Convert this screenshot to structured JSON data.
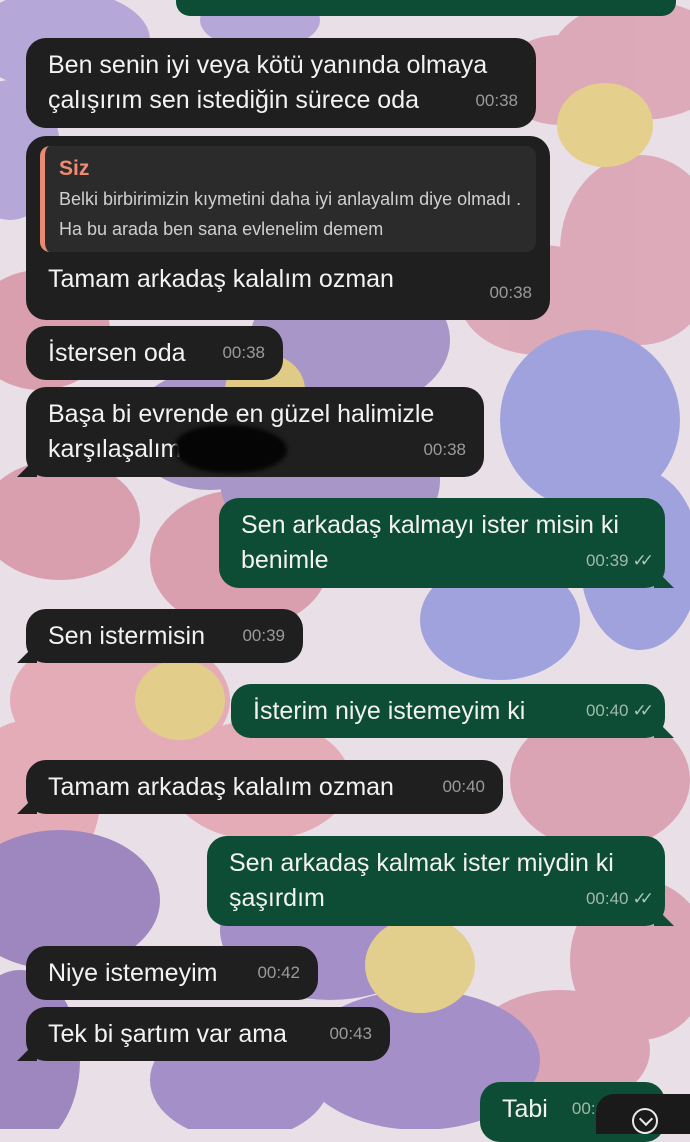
{
  "messages": [
    {
      "id": "m1",
      "dir": "in",
      "text": "Ben senin iyi veya kötü yanında olmaya\nçalışırım sen istediğin sürece oda",
      "time": "00:38"
    },
    {
      "id": "m2",
      "dir": "in",
      "text": "Tamam arkadaş kalalım ozman",
      "time": "00:38",
      "reply": {
        "author": "Siz",
        "text": "Belki birbirimizin kıymetini daha iyi anlayalım diye olmadı . Ha bu arada ben sana evlenelim demem"
      }
    },
    {
      "id": "m3",
      "dir": "in",
      "text": "İstersen oda",
      "time": "00:38"
    },
    {
      "id": "m4",
      "dir": "in",
      "text": "Başa bi evrende en güzel halimizle\nkarşılaşalım",
      "time": "00:38"
    },
    {
      "id": "m5",
      "dir": "out",
      "text": "Sen arkadaş kalmayı ister misin ki\nbenimle",
      "time": "00:39",
      "ticks": "✓✓"
    },
    {
      "id": "m6",
      "dir": "in",
      "text": "Sen istermisin",
      "time": "00:39"
    },
    {
      "id": "m7",
      "dir": "out",
      "text": "İsterim niye istemeyim ki",
      "time": "00:40",
      "ticks": "✓✓"
    },
    {
      "id": "m8",
      "dir": "in",
      "text": "Tamam arkadaş kalalım ozman",
      "time": "00:40"
    },
    {
      "id": "m9",
      "dir": "out",
      "text": "Sen arkadaş kalmak ister miydin ki\nşaşırdım",
      "time": "00:40",
      "ticks": "✓✓"
    },
    {
      "id": "m10",
      "dir": "in",
      "text": "Niye istemeyim",
      "time": "00:42"
    },
    {
      "id": "m11",
      "dir": "in",
      "text": "Tek bi şartım var ama",
      "time": "00:43"
    },
    {
      "id": "m12",
      "dir": "out",
      "text": "Tabi",
      "time": "00:4"
    }
  ],
  "scroll_button": {
    "icon": "chevron-down-icon"
  },
  "colors": {
    "incoming": "#1f1f1f",
    "outgoing": "#0e4d35",
    "quote_accent": "#e98a74"
  }
}
